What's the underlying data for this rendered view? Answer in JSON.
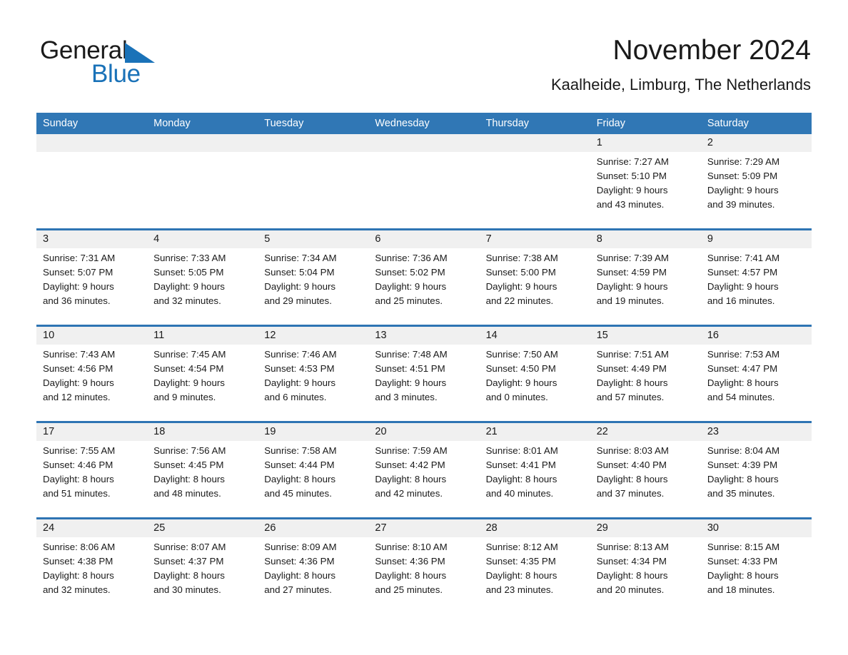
{
  "logo": {
    "word1": "General",
    "word2": "Blue",
    "triangle_color": "#1a72b8"
  },
  "header": {
    "title": "November 2024",
    "subtitle": "Kaalheide, Limburg, The Netherlands"
  },
  "theme": {
    "header_blue": "#3077b5",
    "row_divider_blue": "#2e74b3",
    "daynum_band": "#f0f0f0",
    "text": "#1a1a1a"
  },
  "calendar": {
    "day_headers": [
      "Sunday",
      "Monday",
      "Tuesday",
      "Wednesday",
      "Thursday",
      "Friday",
      "Saturday"
    ],
    "weeks": [
      [
        {
          "day": "",
          "lines": []
        },
        {
          "day": "",
          "lines": []
        },
        {
          "day": "",
          "lines": []
        },
        {
          "day": "",
          "lines": []
        },
        {
          "day": "",
          "lines": []
        },
        {
          "day": "1",
          "lines": [
            "Sunrise: 7:27 AM",
            "Sunset: 5:10 PM",
            "Daylight: 9 hours",
            "and 43 minutes."
          ]
        },
        {
          "day": "2",
          "lines": [
            "Sunrise: 7:29 AM",
            "Sunset: 5:09 PM",
            "Daylight: 9 hours",
            "and 39 minutes."
          ]
        }
      ],
      [
        {
          "day": "3",
          "lines": [
            "Sunrise: 7:31 AM",
            "Sunset: 5:07 PM",
            "Daylight: 9 hours",
            "and 36 minutes."
          ]
        },
        {
          "day": "4",
          "lines": [
            "Sunrise: 7:33 AM",
            "Sunset: 5:05 PM",
            "Daylight: 9 hours",
            "and 32 minutes."
          ]
        },
        {
          "day": "5",
          "lines": [
            "Sunrise: 7:34 AM",
            "Sunset: 5:04 PM",
            "Daylight: 9 hours",
            "and 29 minutes."
          ]
        },
        {
          "day": "6",
          "lines": [
            "Sunrise: 7:36 AM",
            "Sunset: 5:02 PM",
            "Daylight: 9 hours",
            "and 25 minutes."
          ]
        },
        {
          "day": "7",
          "lines": [
            "Sunrise: 7:38 AM",
            "Sunset: 5:00 PM",
            "Daylight: 9 hours",
            "and 22 minutes."
          ]
        },
        {
          "day": "8",
          "lines": [
            "Sunrise: 7:39 AM",
            "Sunset: 4:59 PM",
            "Daylight: 9 hours",
            "and 19 minutes."
          ]
        },
        {
          "day": "9",
          "lines": [
            "Sunrise: 7:41 AM",
            "Sunset: 4:57 PM",
            "Daylight: 9 hours",
            "and 16 minutes."
          ]
        }
      ],
      [
        {
          "day": "10",
          "lines": [
            "Sunrise: 7:43 AM",
            "Sunset: 4:56 PM",
            "Daylight: 9 hours",
            "and 12 minutes."
          ]
        },
        {
          "day": "11",
          "lines": [
            "Sunrise: 7:45 AM",
            "Sunset: 4:54 PM",
            "Daylight: 9 hours",
            "and 9 minutes."
          ]
        },
        {
          "day": "12",
          "lines": [
            "Sunrise: 7:46 AM",
            "Sunset: 4:53 PM",
            "Daylight: 9 hours",
            "and 6 minutes."
          ]
        },
        {
          "day": "13",
          "lines": [
            "Sunrise: 7:48 AM",
            "Sunset: 4:51 PM",
            "Daylight: 9 hours",
            "and 3 minutes."
          ]
        },
        {
          "day": "14",
          "lines": [
            "Sunrise: 7:50 AM",
            "Sunset: 4:50 PM",
            "Daylight: 9 hours",
            "and 0 minutes."
          ]
        },
        {
          "day": "15",
          "lines": [
            "Sunrise: 7:51 AM",
            "Sunset: 4:49 PM",
            "Daylight: 8 hours",
            "and 57 minutes."
          ]
        },
        {
          "day": "16",
          "lines": [
            "Sunrise: 7:53 AM",
            "Sunset: 4:47 PM",
            "Daylight: 8 hours",
            "and 54 minutes."
          ]
        }
      ],
      [
        {
          "day": "17",
          "lines": [
            "Sunrise: 7:55 AM",
            "Sunset: 4:46 PM",
            "Daylight: 8 hours",
            "and 51 minutes."
          ]
        },
        {
          "day": "18",
          "lines": [
            "Sunrise: 7:56 AM",
            "Sunset: 4:45 PM",
            "Daylight: 8 hours",
            "and 48 minutes."
          ]
        },
        {
          "day": "19",
          "lines": [
            "Sunrise: 7:58 AM",
            "Sunset: 4:44 PM",
            "Daylight: 8 hours",
            "and 45 minutes."
          ]
        },
        {
          "day": "20",
          "lines": [
            "Sunrise: 7:59 AM",
            "Sunset: 4:42 PM",
            "Daylight: 8 hours",
            "and 42 minutes."
          ]
        },
        {
          "day": "21",
          "lines": [
            "Sunrise: 8:01 AM",
            "Sunset: 4:41 PM",
            "Daylight: 8 hours",
            "and 40 minutes."
          ]
        },
        {
          "day": "22",
          "lines": [
            "Sunrise: 8:03 AM",
            "Sunset: 4:40 PM",
            "Daylight: 8 hours",
            "and 37 minutes."
          ]
        },
        {
          "day": "23",
          "lines": [
            "Sunrise: 8:04 AM",
            "Sunset: 4:39 PM",
            "Daylight: 8 hours",
            "and 35 minutes."
          ]
        }
      ],
      [
        {
          "day": "24",
          "lines": [
            "Sunrise: 8:06 AM",
            "Sunset: 4:38 PM",
            "Daylight: 8 hours",
            "and 32 minutes."
          ]
        },
        {
          "day": "25",
          "lines": [
            "Sunrise: 8:07 AM",
            "Sunset: 4:37 PM",
            "Daylight: 8 hours",
            "and 30 minutes."
          ]
        },
        {
          "day": "26",
          "lines": [
            "Sunrise: 8:09 AM",
            "Sunset: 4:36 PM",
            "Daylight: 8 hours",
            "and 27 minutes."
          ]
        },
        {
          "day": "27",
          "lines": [
            "Sunrise: 8:10 AM",
            "Sunset: 4:36 PM",
            "Daylight: 8 hours",
            "and 25 minutes."
          ]
        },
        {
          "day": "28",
          "lines": [
            "Sunrise: 8:12 AM",
            "Sunset: 4:35 PM",
            "Daylight: 8 hours",
            "and 23 minutes."
          ]
        },
        {
          "day": "29",
          "lines": [
            "Sunrise: 8:13 AM",
            "Sunset: 4:34 PM",
            "Daylight: 8 hours",
            "and 20 minutes."
          ]
        },
        {
          "day": "30",
          "lines": [
            "Sunrise: 8:15 AM",
            "Sunset: 4:33 PM",
            "Daylight: 8 hours",
            "and 18 minutes."
          ]
        }
      ]
    ]
  }
}
